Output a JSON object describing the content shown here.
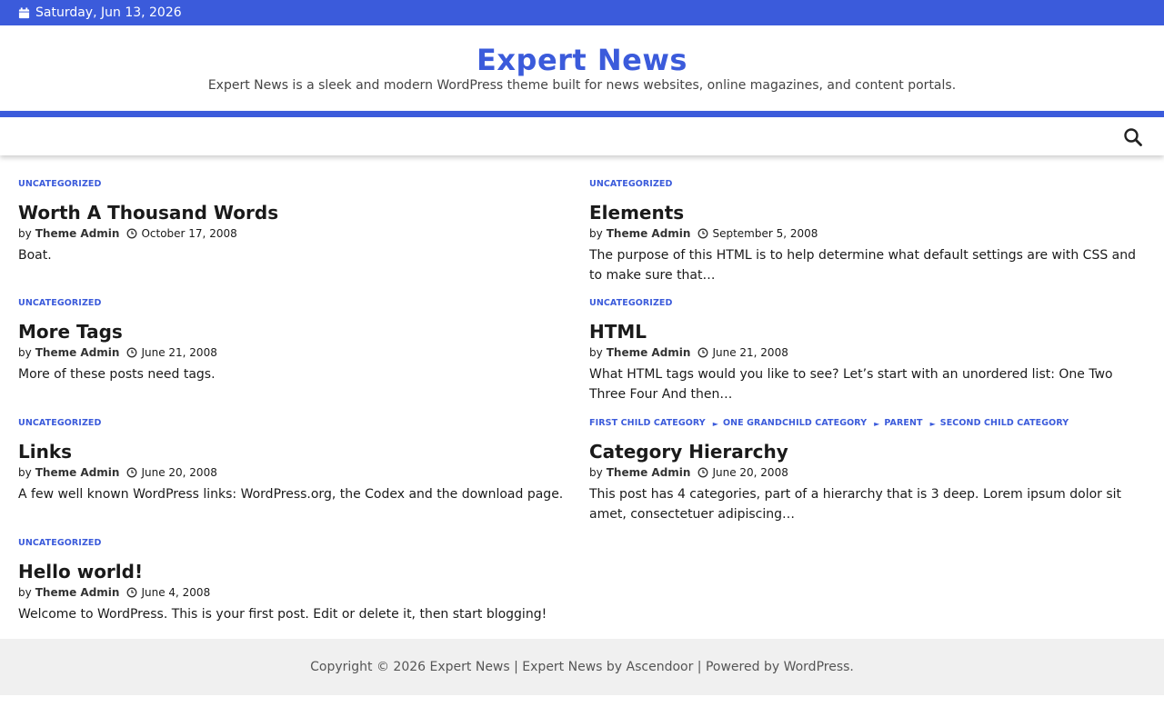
{
  "topbar": {
    "date": "Saturday, Jun 13, 2026",
    "icon": "calendar-icon"
  },
  "header": {
    "title": "Expert News",
    "description": "Expert News is a sleek and modern WordPress theme built for news websites, online magazines, and content portals."
  },
  "nav": {
    "search_icon": "search-icon"
  },
  "colors": {
    "accent": "#3b5bdb",
    "footer_bg": "#f0f0f0"
  },
  "posts": [
    {
      "categories": [
        "UNCATEGORIZED"
      ],
      "title": "Worth A Thousand Words",
      "by": "by",
      "author": "Theme Admin",
      "date": "October 17, 2008",
      "excerpt": "Boat."
    },
    {
      "categories": [
        "UNCATEGORIZED"
      ],
      "title": "Elements",
      "by": "by",
      "author": "Theme Admin",
      "date": "September 5, 2008",
      "excerpt": "The purpose of this HTML is to help determine what default settings are with CSS and to make sure that…"
    },
    {
      "categories": [
        "UNCATEGORIZED"
      ],
      "title": "More Tags",
      "by": "by",
      "author": "Theme Admin",
      "date": "June 21, 2008",
      "excerpt": "More of these posts need tags."
    },
    {
      "categories": [
        "UNCATEGORIZED"
      ],
      "title": "HTML",
      "by": "by",
      "author": "Theme Admin",
      "date": "June 21, 2008",
      "excerpt": "What HTML tags would you like to see? Let’s start with an unordered list: One Two Three Four And then…"
    },
    {
      "categories": [
        "UNCATEGORIZED"
      ],
      "title": "Links",
      "by": "by",
      "author": "Theme Admin",
      "date": "June 20, 2008",
      "excerpt": "A few well known WordPress links: WordPress.org, the Codex and the download page."
    },
    {
      "categories": [
        "FIRST CHILD CATEGORY",
        "ONE GRANDCHILD CATEGORY",
        "PARENT",
        "SECOND CHILD CATEGORY"
      ],
      "title": "Category Hierarchy",
      "by": "by",
      "author": "Theme Admin",
      "date": "June 20, 2008",
      "excerpt": "This post has 4 categories, part of a hierarchy that is 3 deep. Lorem ipsum dolor sit amet, consectetuer adipiscing…"
    },
    {
      "categories": [
        "UNCATEGORIZED"
      ],
      "title": "Hello world!",
      "by": "by",
      "author": "Theme Admin",
      "date": "June 4, 2008",
      "excerpt": "Welcome to WordPress. This is your first post. Edit or delete it, then start blogging!"
    }
  ],
  "footer": {
    "copyright": "Copyright © 2026",
    "site_link": "Expert News",
    "sep1": " | ",
    "theme_text": "Expert News by",
    "author_link": "Ascendoor",
    "powered": " | Powered by",
    "wp_link": "WordPress",
    "end": "."
  }
}
